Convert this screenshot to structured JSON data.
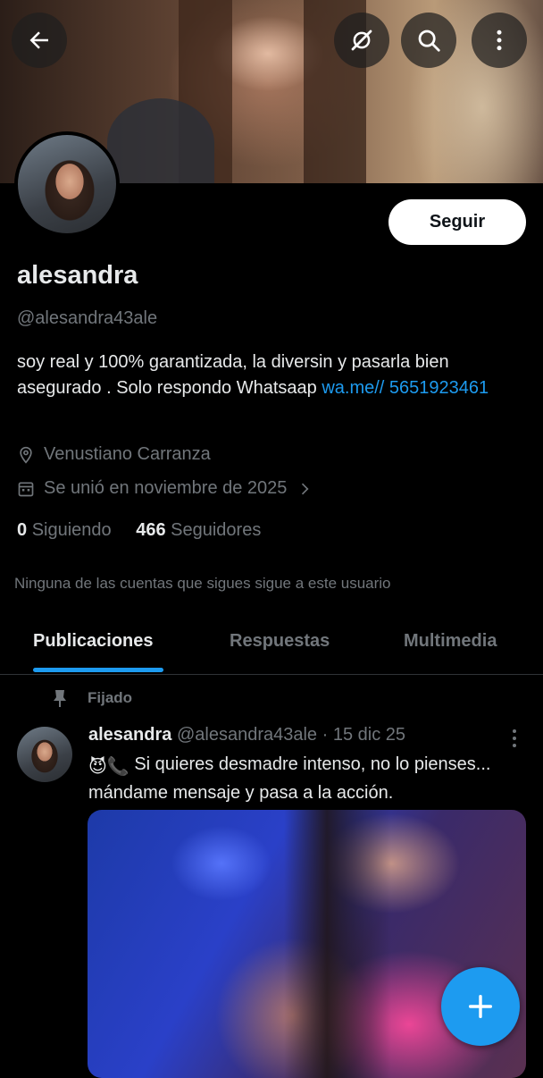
{
  "profile": {
    "name": "alesandra",
    "handle": "@alesandra43ale",
    "bio_text": "soy real y 100% garantizada, la diversin y pasarla bien asegurado . Solo respondo Whatsaap ",
    "bio_link": "wa.me// 5651923461",
    "location": "Venustiano Carranza",
    "joined": "Se unió en noviembre de 2025",
    "following_count": "0",
    "following_label": "Siguiendo",
    "followers_count": "466",
    "followers_label": "Seguidores",
    "mutual_note": "Ninguna de las cuentas que sigues sigue a este usuario",
    "follow_button": "Seguir"
  },
  "tabs": [
    {
      "label": "Publicaciones",
      "active": true
    },
    {
      "label": "Respuestas",
      "active": false
    },
    {
      "label": "Multimedia",
      "active": false
    }
  ],
  "post": {
    "pinned_label": "Fijado",
    "author_name": "alesandra",
    "author_handle": "@alesandra43ale",
    "separator": "·",
    "date": "15 dic 25",
    "emojis": "😈📞",
    "text": " Si quieres desmadre intenso, no lo pienses... mándame mensaje y pasa a la acción."
  },
  "icons": {
    "back": "back-arrow-icon",
    "grok": "grok-icon",
    "search": "search-icon",
    "more": "more-vertical-icon",
    "location": "location-pin-icon",
    "calendar": "calendar-icon",
    "pin": "pin-icon",
    "compose": "plus-icon"
  },
  "colors": {
    "accent": "#1d9bf0",
    "background": "#000000",
    "secondary_text": "#71767b"
  }
}
